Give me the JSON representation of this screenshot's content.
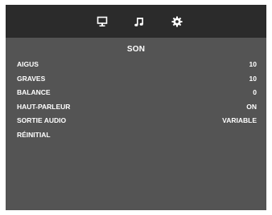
{
  "tabs": [
    {
      "icon": "monitor-icon"
    },
    {
      "icon": "music-note-icon"
    },
    {
      "icon": "gear-icon"
    }
  ],
  "menu": {
    "title": "SON",
    "items": [
      {
        "label": "AIGUS",
        "value": "10"
      },
      {
        "label": "GRAVES",
        "value": "10"
      },
      {
        "label": "BALANCE",
        "value": "0"
      },
      {
        "label": "HAUT-PARLEUR",
        "value": "ON"
      },
      {
        "label": "SORTIE AUDIO",
        "value": "VARIABLE"
      },
      {
        "label": "RÉINITIAL",
        "value": ""
      }
    ]
  },
  "colors": {
    "panel": "#545454",
    "topbar": "#2b2b2b",
    "text": "#ffffff"
  }
}
